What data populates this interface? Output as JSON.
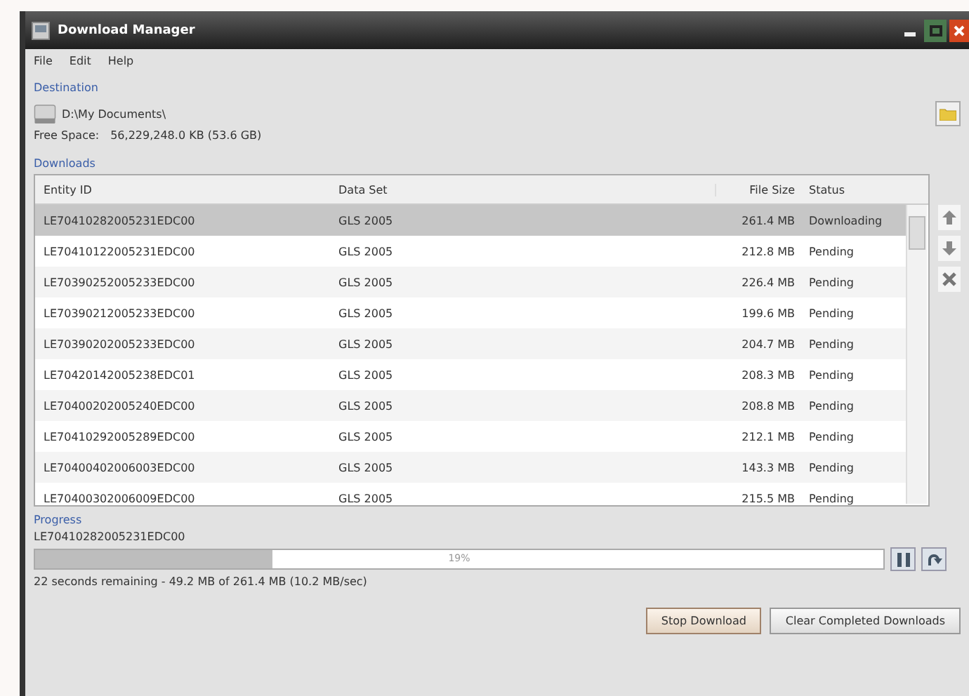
{
  "window": {
    "title": "Download Manager"
  },
  "menu": [
    "File",
    "Edit",
    "Help"
  ],
  "destination": {
    "label": "Destination",
    "path": "D:\\My Documents\\",
    "free_space_label": "Free Space:",
    "free_space": "56,229,248.0 KB (53.6 GB)"
  },
  "downloads": {
    "label": "Downloads",
    "columns": [
      "Entity ID",
      "Data Set",
      "File Size",
      "Status"
    ],
    "rows": [
      {
        "entity_id": "LE70410282005231EDC00",
        "data_set": "GLS 2005",
        "file_size": "261.4 MB",
        "status": "Downloading",
        "selected": true
      },
      {
        "entity_id": "LE70410122005231EDC00",
        "data_set": "GLS 2005",
        "file_size": "212.8 MB",
        "status": "Pending",
        "selected": false
      },
      {
        "entity_id": "LE70390252005233EDC00",
        "data_set": "GLS 2005",
        "file_size": "226.4 MB",
        "status": "Pending",
        "selected": false
      },
      {
        "entity_id": "LE70390212005233EDC00",
        "data_set": "GLS 2005",
        "file_size": "199.6 MB",
        "status": "Pending",
        "selected": false
      },
      {
        "entity_id": "LE70390202005233EDC00",
        "data_set": "GLS 2005",
        "file_size": "204.7 MB",
        "status": "Pending",
        "selected": false
      },
      {
        "entity_id": "LE70420142005238EDC01",
        "data_set": "GLS 2005",
        "file_size": "208.3 MB",
        "status": "Pending",
        "selected": false
      },
      {
        "entity_id": "LE70400202005240EDC00",
        "data_set": "GLS 2005",
        "file_size": "208.8 MB",
        "status": "Pending",
        "selected": false
      },
      {
        "entity_id": "LE70410292005289EDC00",
        "data_set": "GLS 2005",
        "file_size": "212.1 MB",
        "status": "Pending",
        "selected": false
      },
      {
        "entity_id": "LE70400402006003EDC00",
        "data_set": "GLS 2005",
        "file_size": "143.3 MB",
        "status": "Pending",
        "selected": false
      },
      {
        "entity_id": "LE70400302006009EDC00",
        "data_set": "GLS 2005",
        "file_size": "215.5 MB",
        "status": "Pending",
        "selected": false
      }
    ]
  },
  "progress": {
    "label": "Progress",
    "entity_id": "LE70410282005231EDC00",
    "level": 0.28,
    "percent": "19%",
    "remaining": "22 seconds remaining - 49.2 MB of 261.4 MB (10.2 MB/sec)"
  },
  "buttons": [
    "Stop Download",
    "Clear Completed Downloads"
  ]
}
